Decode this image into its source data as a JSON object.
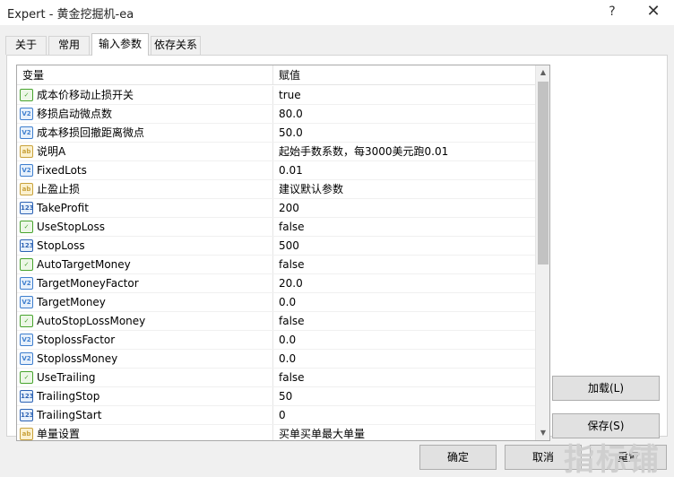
{
  "window": {
    "title": "Expert - 黄金挖掘机-ea",
    "help_glyph": "?",
    "close_glyph": "✕"
  },
  "tabs": [
    {
      "label": "关于"
    },
    {
      "label": "常用"
    },
    {
      "label": "输入参数"
    },
    {
      "label": "依存关系"
    }
  ],
  "grid": {
    "col_variable": "变量",
    "col_value": "赋值",
    "rows": [
      {
        "name": "成本价移动止损开关",
        "value": "true",
        "type": "bool"
      },
      {
        "name": "移损启动微点数",
        "value": "80.0",
        "type": "double"
      },
      {
        "name": "成本移损回撤距离微点",
        "value": "50.0",
        "type": "double"
      },
      {
        "name": "说明A",
        "value": "起始手数系数，每3000美元跑0.01",
        "type": "string"
      },
      {
        "name": "FixedLots",
        "value": "0.01",
        "type": "double"
      },
      {
        "name": "止盈止损",
        "value": "建议默认参数",
        "type": "string"
      },
      {
        "name": "TakeProfit",
        "value": "200",
        "type": "int"
      },
      {
        "name": "UseStopLoss",
        "value": "false",
        "type": "bool"
      },
      {
        "name": "StopLoss",
        "value": "500",
        "type": "int"
      },
      {
        "name": "AutoTargetMoney",
        "value": "false",
        "type": "bool"
      },
      {
        "name": "TargetMoneyFactor",
        "value": "20.0",
        "type": "double"
      },
      {
        "name": "TargetMoney",
        "value": "0.0",
        "type": "double"
      },
      {
        "name": "AutoStopLossMoney",
        "value": "false",
        "type": "bool"
      },
      {
        "name": "StoplossFactor",
        "value": "0.0",
        "type": "double"
      },
      {
        "name": "StoplossMoney",
        "value": "0.0",
        "type": "double"
      },
      {
        "name": "UseTrailing",
        "value": "false",
        "type": "bool"
      },
      {
        "name": "TrailingStop",
        "value": "50",
        "type": "int"
      },
      {
        "name": "TrailingStart",
        "value": "0",
        "type": "int"
      },
      {
        "name": "单量设置",
        "value": "买单买单最大单量",
        "type": "string"
      }
    ]
  },
  "icons": {
    "bool": {
      "name": "bool-param-icon",
      "glyph": "✓",
      "color": "#48a42e"
    },
    "double": {
      "name": "double-param-icon",
      "glyph": "V2",
      "color": "#3f7fce"
    },
    "int": {
      "name": "int-param-icon",
      "glyph": "123",
      "color": "#2d63b4"
    },
    "string": {
      "name": "string-param-icon",
      "glyph": "ab",
      "color": "#c9a23c"
    }
  },
  "scrollbar": {
    "up_glyph": "▲",
    "down_glyph": "▼"
  },
  "buttons": {
    "load": "加载(L)",
    "save": "保存(S)",
    "ok": "确定",
    "cancel": "取消",
    "reset": "重置"
  },
  "watermark": "指标铺"
}
